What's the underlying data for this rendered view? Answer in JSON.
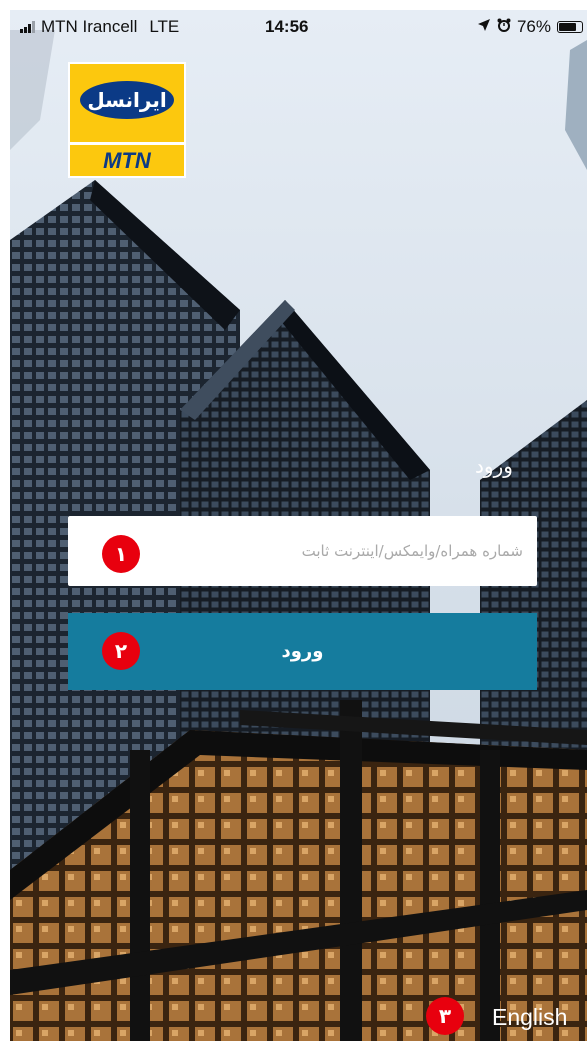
{
  "status_bar": {
    "carrier": "MTN Irancell",
    "network": "LTE",
    "time": "14:56",
    "battery": "76%",
    "icons": [
      "signal-icon",
      "location-arrow-icon",
      "alarm-icon",
      "battery-icon"
    ]
  },
  "logo": {
    "brand_fa": "ایرانسل",
    "brand_en": "MTN"
  },
  "login": {
    "heading": "ورود",
    "phone_placeholder": "شماره همراه/وایمکس/اینترنت ثابت",
    "phone_value": "",
    "submit_label": "ورود"
  },
  "footer": {
    "language_link": "English"
  },
  "annotations": {
    "badge_1": "۱",
    "badge_2": "۲",
    "badge_3": "۳"
  },
  "colors": {
    "button": "#157c9e",
    "badge": "#e8000e",
    "logo_yellow": "#fcc80e",
    "logo_blue": "#0b3a86"
  }
}
